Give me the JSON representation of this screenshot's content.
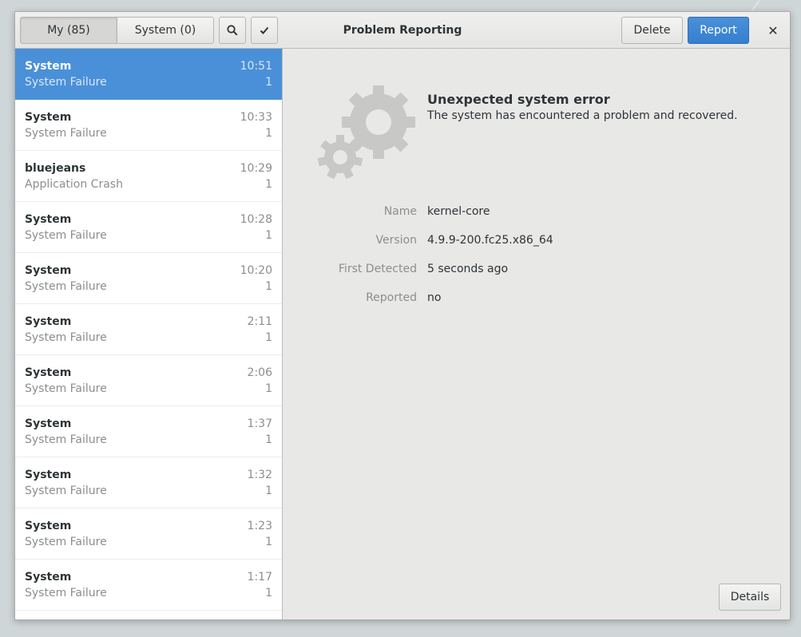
{
  "header": {
    "tabs": [
      {
        "label": "My (85)",
        "active": true
      },
      {
        "label": "System (0)",
        "active": false
      }
    ],
    "search_icon": "search-icon",
    "select_icon": "checkmark-icon",
    "title": "Problem Reporting",
    "delete_label": "Delete",
    "report_label": "Report",
    "close_glyph": "✕"
  },
  "problems": [
    {
      "name": "System",
      "type": "System Failure",
      "time": "10:51",
      "count": "1",
      "selected": true
    },
    {
      "name": "System",
      "type": "System Failure",
      "time": "10:33",
      "count": "1"
    },
    {
      "name": "bluejeans",
      "type": "Application Crash",
      "time": "10:29",
      "count": "1"
    },
    {
      "name": "System",
      "type": "System Failure",
      "time": "10:28",
      "count": "1"
    },
    {
      "name": "System",
      "type": "System Failure",
      "time": "10:20",
      "count": "1"
    },
    {
      "name": "System",
      "type": "System Failure",
      "time": "2:11",
      "count": "1"
    },
    {
      "name": "System",
      "type": "System Failure",
      "time": "2:06",
      "count": "1"
    },
    {
      "name": "System",
      "type": "System Failure",
      "time": "1:37",
      "count": "1"
    },
    {
      "name": "System",
      "type": "System Failure",
      "time": "1:32",
      "count": "1"
    },
    {
      "name": "System",
      "type": "System Failure",
      "time": "1:23",
      "count": "1"
    },
    {
      "name": "System",
      "type": "System Failure",
      "time": "1:17",
      "count": "1"
    }
  ],
  "detail": {
    "icon": "gears-icon",
    "title": "Unexpected system error",
    "subtitle": "The system has encountered a problem and recovered.",
    "fields": [
      {
        "label": "Name",
        "value": "kernel-core"
      },
      {
        "label": "Version",
        "value": "4.9.9-200.fc25.x86_64"
      },
      {
        "label": "First Detected",
        "value": "5 seconds ago"
      },
      {
        "label": "Reported",
        "value": "no"
      }
    ],
    "details_label": "Details"
  },
  "colors": {
    "accent": "#4a90d9",
    "window_bg": "#e8e8e7"
  }
}
